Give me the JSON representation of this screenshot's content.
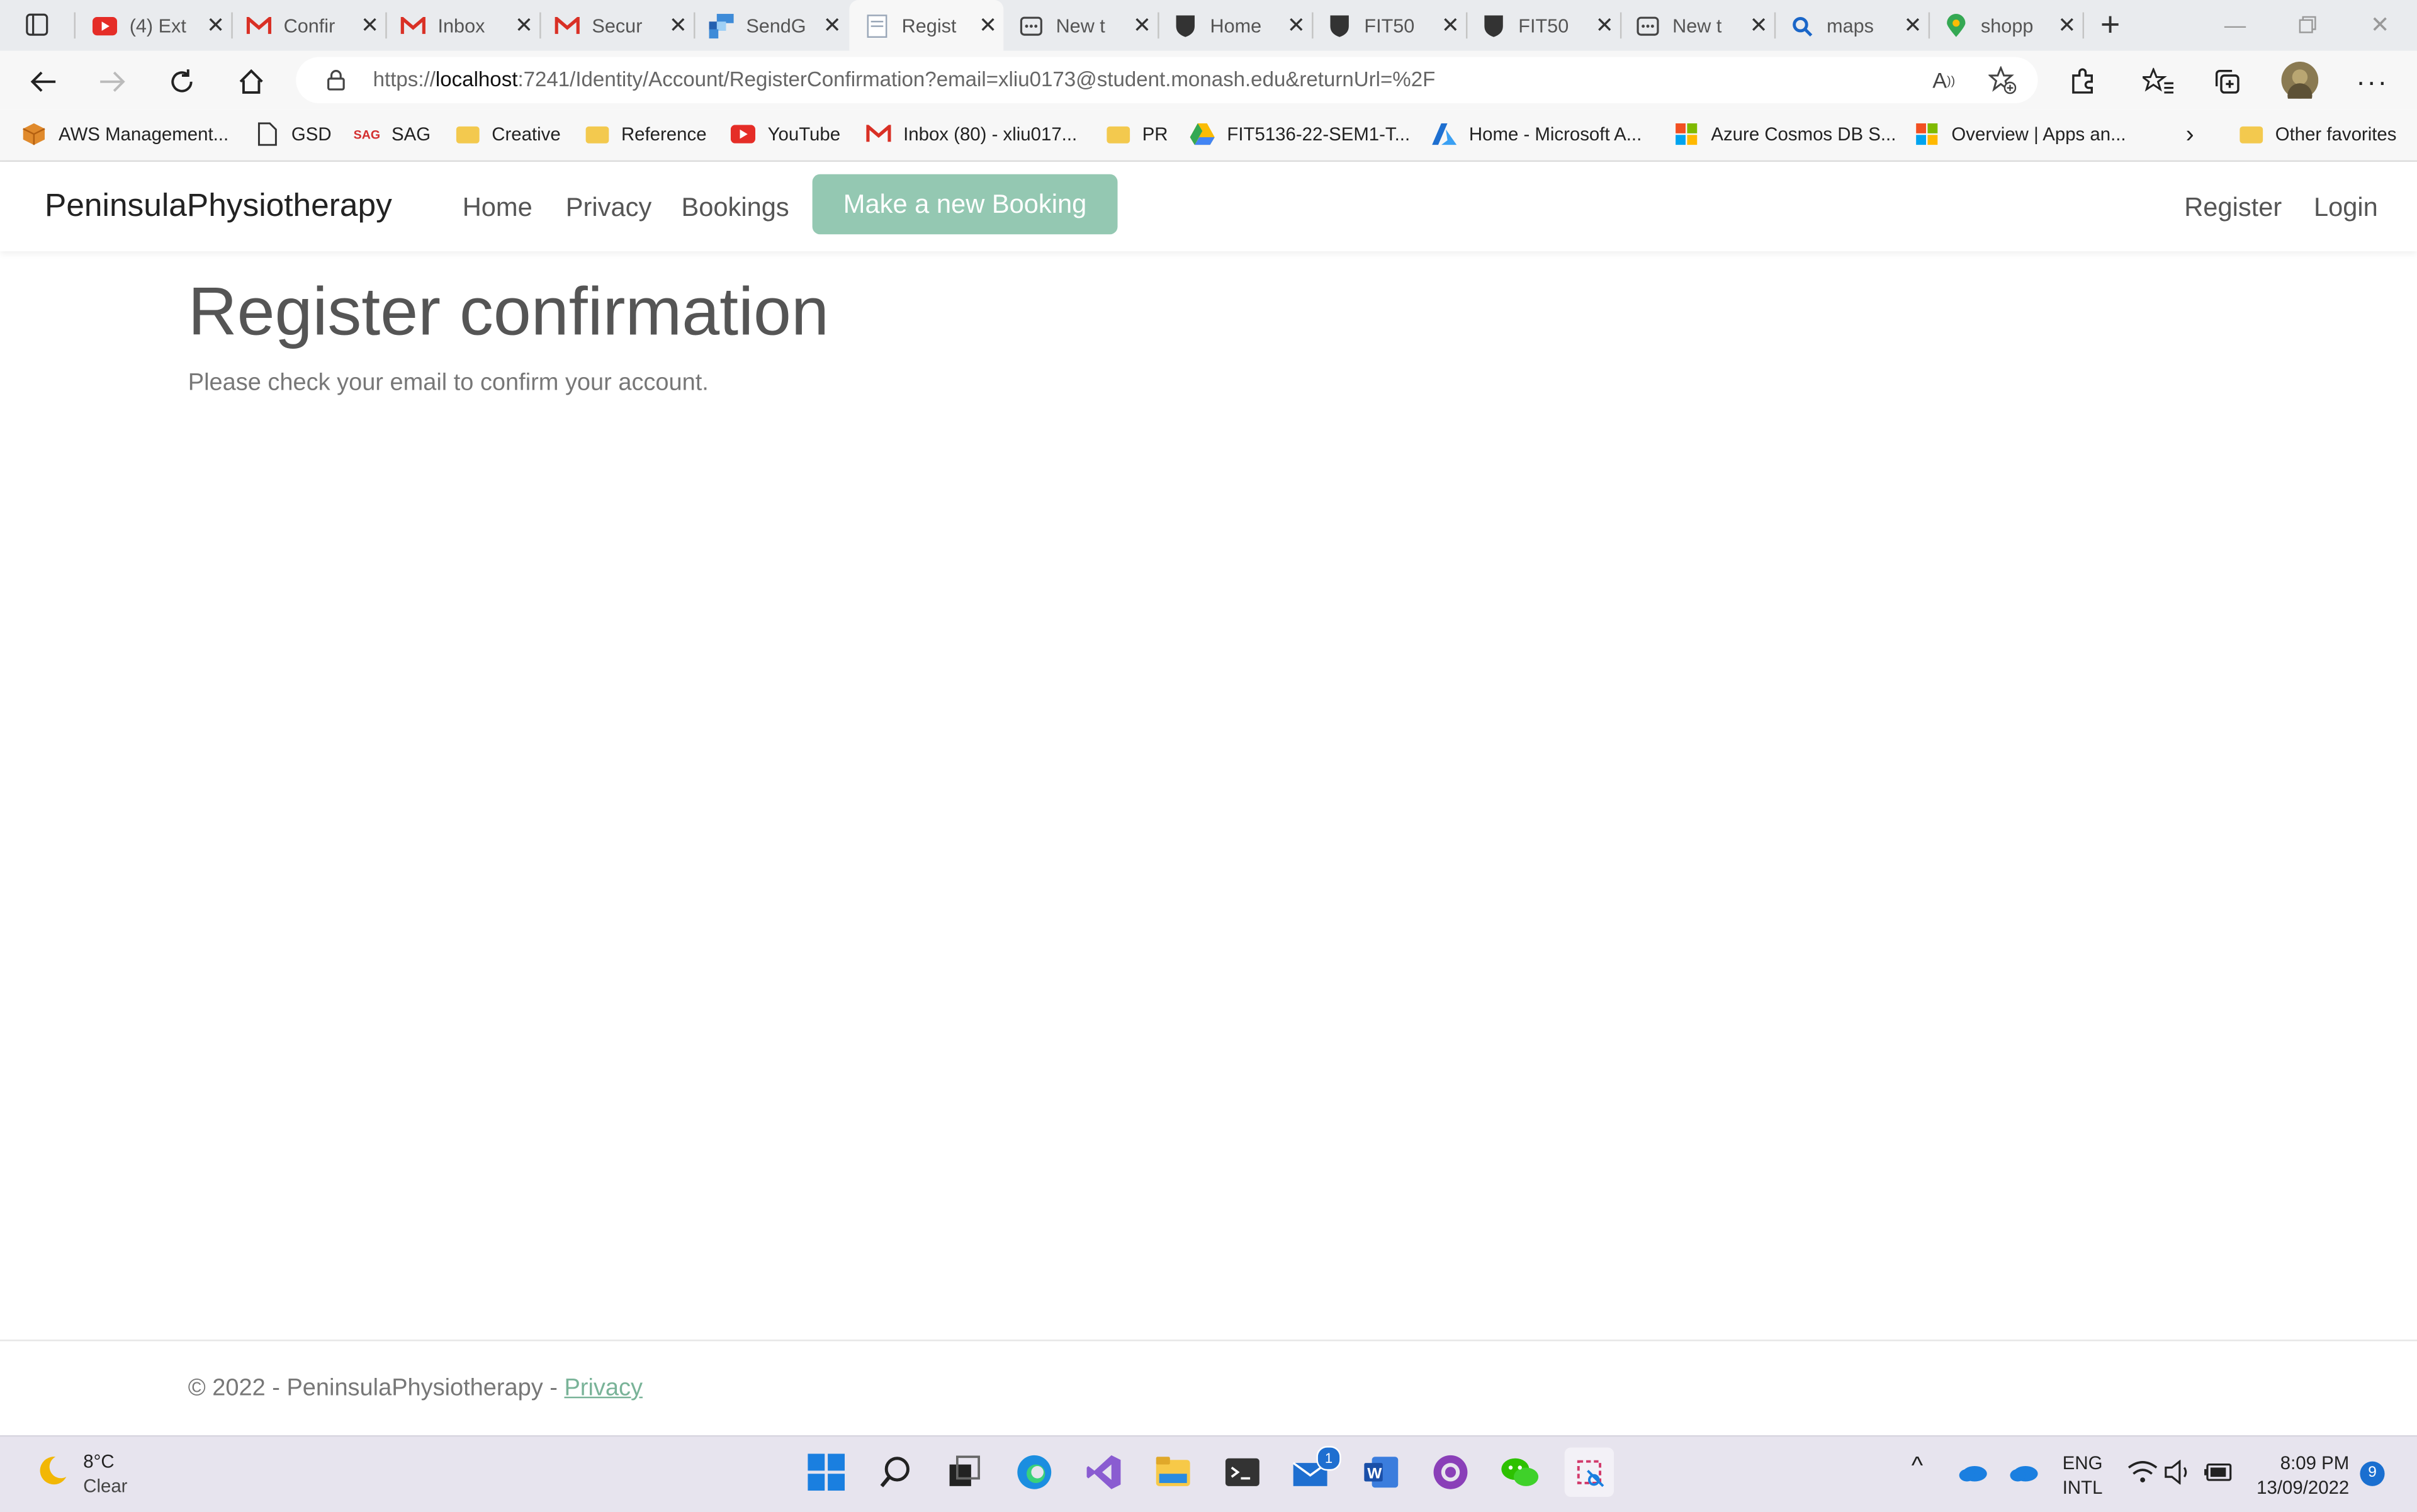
{
  "browser": {
    "tabs": [
      {
        "title": "(4) Ext"
      },
      {
        "title": "Confir"
      },
      {
        "title": "Inbox"
      },
      {
        "title": "Secur"
      },
      {
        "title": "SendG"
      },
      {
        "title": "Regist"
      },
      {
        "title": "New t"
      },
      {
        "title": "Home"
      },
      {
        "title": "FIT50"
      },
      {
        "title": "FIT50"
      },
      {
        "title": "New t"
      },
      {
        "title": "maps"
      },
      {
        "title": "shopp"
      }
    ],
    "url_prefix": "https://",
    "url_host": "localhost",
    "url_rest": ":7241/Identity/Account/RegisterConfirmation?email=xliu0173@student.monash.edu&returnUrl=%2F"
  },
  "favorites": [
    {
      "label": "AWS Management..."
    },
    {
      "label": "GSD"
    },
    {
      "label": "SAG"
    },
    {
      "label": "Creative"
    },
    {
      "label": "Reference"
    },
    {
      "label": "YouTube"
    },
    {
      "label": "Inbox (80) - xliu017..."
    },
    {
      "label": "PR"
    },
    {
      "label": "FIT5136-22-SEM1-T..."
    },
    {
      "label": "Home - Microsoft A..."
    },
    {
      "label": "Azure Cosmos DB S..."
    },
    {
      "label": "Overview | Apps an..."
    },
    {
      "label": "Other favorites"
    }
  ],
  "site": {
    "brand": "PeninsulaPhysiotherapy",
    "nav": {
      "home": "Home",
      "privacy": "Privacy",
      "bookings": "Bookings",
      "new_booking": "Make a new Booking",
      "register": "Register",
      "login": "Login"
    },
    "heading": "Register confirmation",
    "message": "Please check your email to confirm your account.",
    "footer_text": "© 2022 - PeninsulaPhysiotherapy - ",
    "footer_link": "Privacy"
  },
  "taskbar": {
    "temp": "8°C",
    "condition": "Clear",
    "mail_badge": "1",
    "lang1": "ENG",
    "lang2": "INTL",
    "time": "8:09 PM",
    "date": "13/09/2022",
    "notifications": "9"
  }
}
